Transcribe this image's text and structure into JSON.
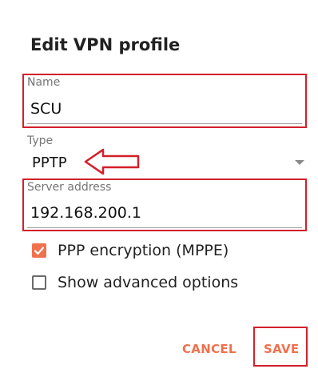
{
  "dialog": {
    "title": "Edit VPN profile"
  },
  "fields": {
    "name": {
      "label": "Name",
      "value": "SCU"
    },
    "type": {
      "label": "Type",
      "value": "PPTP"
    },
    "server": {
      "label": "Server address",
      "value": "192.168.200.1"
    }
  },
  "options": {
    "ppp_encryption": {
      "label": "PPP encryption (MPPE)",
      "checked": true
    },
    "advanced": {
      "label": "Show advanced options",
      "checked": false
    }
  },
  "buttons": {
    "cancel": "CANCEL",
    "save": "SAVE"
  },
  "colors": {
    "accent": "#f0714e",
    "annotation": "#d3202a"
  },
  "icons": {
    "dropdown": "triangle-down-icon",
    "annotation_arrow": "arrow-left-icon",
    "checkmark": "checkmark-icon"
  }
}
